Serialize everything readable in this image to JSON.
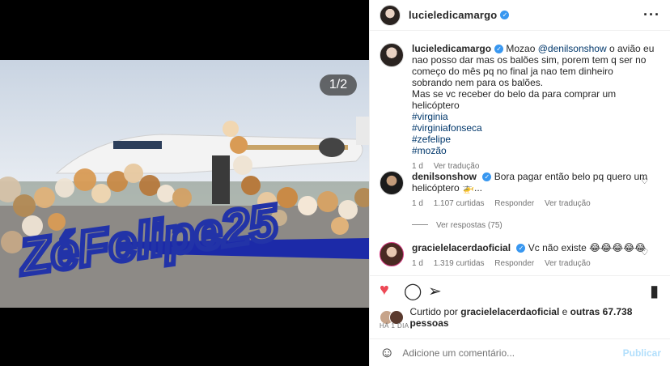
{
  "media": {
    "counter": "1/2"
  },
  "header": {
    "username": "lucieledicamargo"
  },
  "caption": {
    "username": "lucieledicamargo",
    "text_start": "Mozao ",
    "mention": "@denilsonshow",
    "text_mid": " o avião eu nao posso dar mas os balões sim, porem tem q ser no começo do mês pq no final ja nao tem dinheiro sobrando nem para os balões.",
    "line2": "Mas se vc receber do belo da para comprar um helicóptero",
    "hashtags": [
      "#virginia",
      "#virginiafonseca",
      "#zefelipe",
      "#mozão"
    ],
    "time": "1 d",
    "translate": "Ver tradução"
  },
  "comments": [
    {
      "username": "denilsonshow",
      "text": "Bora pagar então belo pq quero um helicóptero 🚁...",
      "time": "1 d",
      "likes": "1.107 curtidas",
      "reply": "Responder",
      "translate": "Ver tradução"
    },
    {
      "username": "gracielelacerdaoficial",
      "text": "Vc não existe 😂😂😂😂😂",
      "time": "1 d",
      "likes": "1.319 curtidas",
      "reply": "Responder",
      "translate": "Ver tradução"
    }
  ],
  "view_replies": "Ver respostas (75)",
  "likes_text": {
    "prefix": "Curtido por ",
    "user": "gracielelacerdaoficial",
    "mid": " e ",
    "others": "outras 67.738 pessoas"
  },
  "date": "HÁ 1 DIA",
  "add_comment": {
    "placeholder": "Adicione um comentário...",
    "post": "Publicar"
  },
  "colors": {
    "link": "#00376b",
    "verified": "#3897f0",
    "like_red": "#ed4956",
    "balloon_gold": "#d9a66a",
    "blue_letters": "#2233a8"
  },
  "icons": [
    "more-icon",
    "heart-icon",
    "comment-icon",
    "share-icon",
    "bookmark-icon",
    "emoji-icon",
    "verified-icon"
  ]
}
